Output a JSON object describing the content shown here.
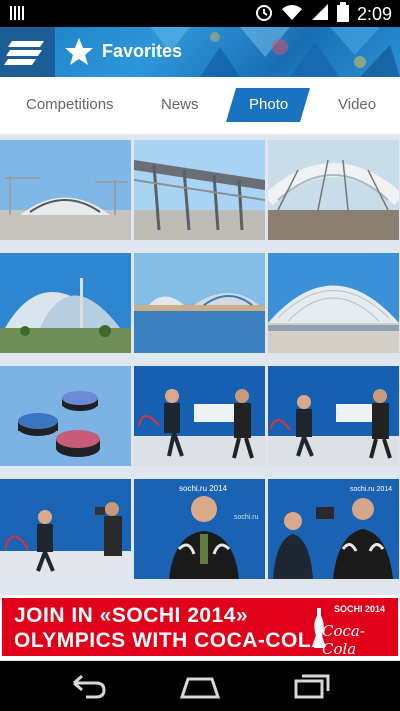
{
  "status": {
    "time": "2:09"
  },
  "appbar": {
    "title": "Favorites"
  },
  "tabs": [
    {
      "label": "Competitions"
    },
    {
      "label": "News"
    },
    {
      "label": "Photo"
    },
    {
      "label": "Video"
    }
  ],
  "ad": {
    "line1": "JOIN IN «SOCHI 2014»",
    "line2": "OLYMPICS WITH COCA-COLA",
    "logo_event": "SOCHI 2014",
    "logo_brand": "Coca-Cola"
  },
  "colors": {
    "accent": "#1a73c1",
    "ad_red": "#e0001a"
  }
}
